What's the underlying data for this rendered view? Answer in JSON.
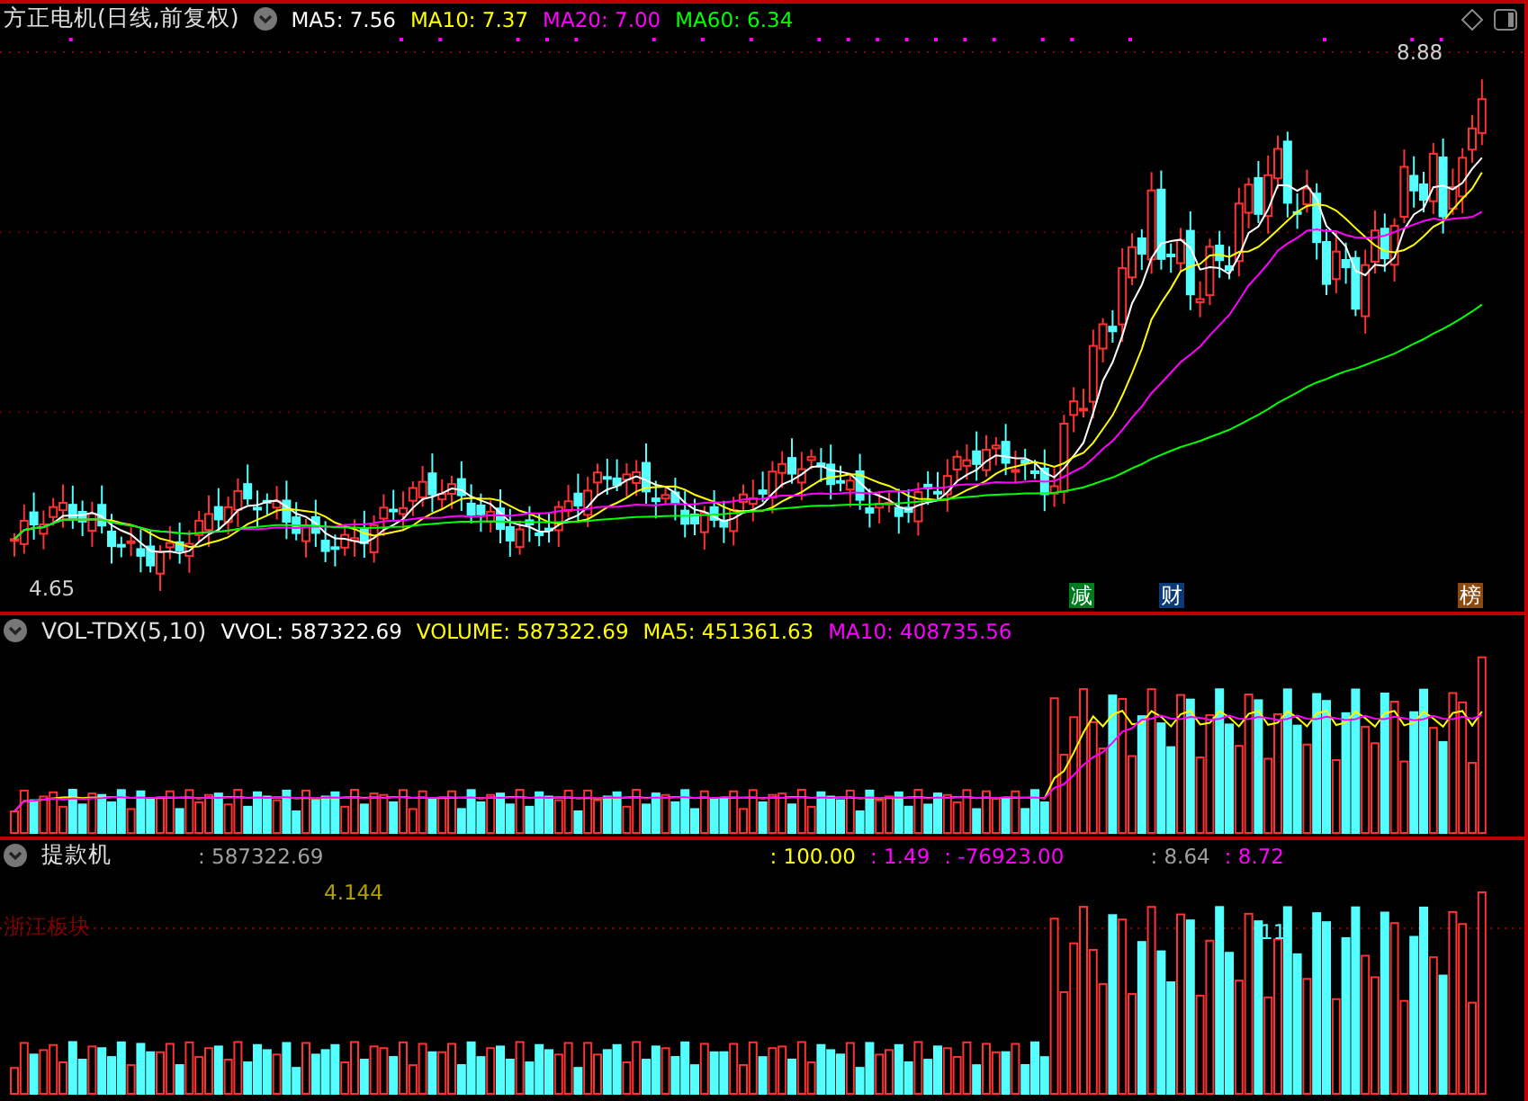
{
  "main": {
    "title": "方正电机(日线,前复权)",
    "ma": [
      {
        "label": "MA5: 7.56",
        "color": "#ffffff"
      },
      {
        "label": "MA10: 7.37",
        "color": "#ffff00"
      },
      {
        "label": "MA20: 7.00",
        "color": "#ff00ff"
      },
      {
        "label": "MA60: 6.34",
        "color": "#00ff00"
      }
    ],
    "high_label": "8.88",
    "low_label": "4.65",
    "markers": [
      {
        "text": "减",
        "color": "#007a1f"
      },
      {
        "text": "财",
        "color": "#0b3a78"
      },
      {
        "text": "榜",
        "color": "#8a4a10"
      }
    ]
  },
  "volume": {
    "title": "VOL-TDX(5,10)",
    "readings": [
      {
        "label": "VVOL: 587322.69",
        "color": "#ffffff"
      },
      {
        "label": "VOLUME: 587322.69",
        "color": "#ffff00"
      },
      {
        "label": "MA5: 451361.63",
        "color": "#ffff00"
      },
      {
        "label": "MA10: 408735.56",
        "color": "#ff00ff"
      }
    ]
  },
  "indicator": {
    "title": "提款机",
    "readings": [
      {
        "label": ": 587322.69",
        "color": "#a0a0a0"
      },
      {
        "label": ": 100.00",
        "color": "#ffff00"
      },
      {
        "label": ": 1.49",
        "color": "#ff00ff"
      },
      {
        "label": ": -76923.00",
        "color": "#ff00ff"
      },
      {
        "label": ": 8.64",
        "color": "#a0a0a0"
      },
      {
        "label": ": 8.72",
        "color": "#ff00ff"
      }
    ],
    "value_text": "4.144",
    "sector": "浙江板块",
    "peak_label": "11"
  }
}
